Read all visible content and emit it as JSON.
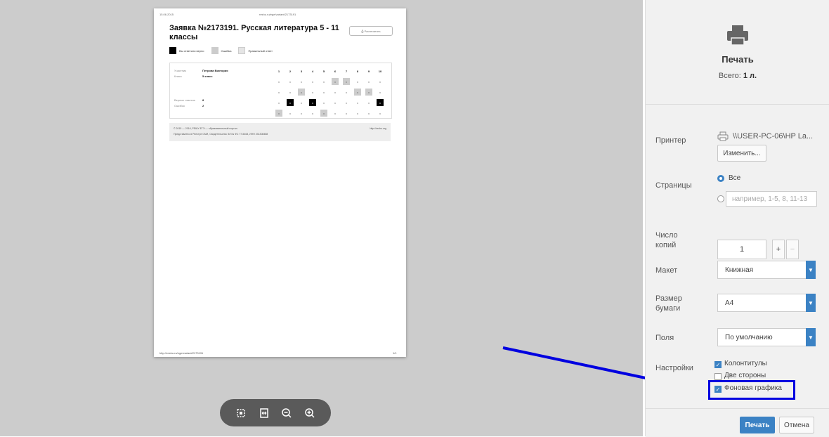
{
  "preview": {
    "header_date": "15.06.2015",
    "header_url": "reshu.ru/ege/variant/2173191",
    "doc_title": "Заявка №2173191. Русская литература 5 - 11 классы",
    "print_button": "Распечатать",
    "legend": [
      "Вы ответили верно",
      "Ошибка",
      "Правильный ответ"
    ],
    "table_labels": [
      "Участник",
      "Класс",
      "Верных ответов",
      "Ошибок"
    ],
    "table_values": [
      "Петрова Виктория",
      "5 класс",
      "8",
      "2"
    ],
    "col_headers": [
      "1",
      "2",
      "3",
      "4",
      "5",
      "6",
      "7",
      "8",
      "9",
      "10"
    ],
    "grid_rows": [
      [
        {
          "t": "x",
          "s": ""
        },
        {
          "t": "x",
          "s": ""
        },
        {
          "t": "x",
          "s": ""
        },
        {
          "t": "x",
          "s": ""
        },
        {
          "t": "x",
          "s": ""
        },
        {
          "t": "x",
          "s": "g"
        },
        {
          "t": "x",
          "s": "g"
        },
        {
          "t": "x",
          "s": ""
        },
        {
          "t": "x",
          "s": ""
        },
        {
          "t": "x",
          "s": ""
        }
      ],
      [
        {
          "t": "x",
          "s": ""
        },
        {
          "t": "x",
          "s": ""
        },
        {
          "t": "x",
          "s": "g"
        },
        {
          "t": "x",
          "s": ""
        },
        {
          "t": "x",
          "s": ""
        },
        {
          "t": "x",
          "s": ""
        },
        {
          "t": "x",
          "s": ""
        },
        {
          "t": "x",
          "s": "g"
        },
        {
          "t": "x",
          "s": "g"
        },
        {
          "t": "x",
          "s": ""
        }
      ],
      [
        {
          "t": "x",
          "s": ""
        },
        {
          "t": "x",
          "s": "b"
        },
        {
          "t": "x",
          "s": ""
        },
        {
          "t": "x",
          "s": "b"
        },
        {
          "t": "x",
          "s": ""
        },
        {
          "t": "x",
          "s": ""
        },
        {
          "t": "x",
          "s": ""
        },
        {
          "t": "x",
          "s": ""
        },
        {
          "t": "x",
          "s": ""
        },
        {
          "t": "x",
          "s": "b"
        }
      ],
      [
        {
          "t": "x",
          "s": "g"
        },
        {
          "t": "x",
          "s": ""
        },
        {
          "t": "x",
          "s": ""
        },
        {
          "t": "x",
          "s": ""
        },
        {
          "t": "x",
          "s": "g"
        },
        {
          "t": "x",
          "s": ""
        },
        {
          "t": "x",
          "s": ""
        },
        {
          "t": "x",
          "s": ""
        },
        {
          "t": "x",
          "s": ""
        },
        {
          "t": "x",
          "s": ""
        }
      ]
    ],
    "footer_line1": "© 2015 — 2016, РЕШУ ЕГЭ — образовательный портал",
    "footer_line2": "Представлено в Реестре СМИ, Свидетельство ЭЛ № ФС 77-5463, ИНН 231308488",
    "footer_right": "http://reshu.org",
    "footer_url": "http://reshu.ru/ege/variant/2173191",
    "page_num": "1/1"
  },
  "toolbar": {
    "fit_icon": "fit-page-icon",
    "rotate_icon": "fit-width-icon",
    "zoom_out_icon": "zoom-out-icon",
    "zoom_in_icon": "zoom-in-icon"
  },
  "panel": {
    "title": "Печать",
    "total_label": "Всего:",
    "total_value": "1 л.",
    "printer_label": "Принтер",
    "printer_name": "\\\\USER-PC-06\\HP La...",
    "change_button": "Изменить...",
    "pages_label": "Страницы",
    "pages_all": "Все",
    "pages_placeholder": "например, 1-5, 8, 11-13",
    "copies_label": "Число копий",
    "copies_value": "1",
    "copies_plus": "+",
    "copies_minus": "−",
    "layout_label": "Макет",
    "layout_value": "Книжная",
    "paper_label": "Размер бумаги",
    "paper_value": "A4",
    "margins_label": "Поля",
    "margins_value": "По умолчанию",
    "settings_label": "Настройки",
    "opt_headers": "Колонтитулы",
    "opt_duplex": "Две стороны",
    "opt_background": "Фоновая графика",
    "print_button": "Печать",
    "cancel_button": "Отмена"
  },
  "colors": {
    "accent": "#3b82c4",
    "highlight": "#0000e0",
    "preview_bg": "#cccccc"
  }
}
